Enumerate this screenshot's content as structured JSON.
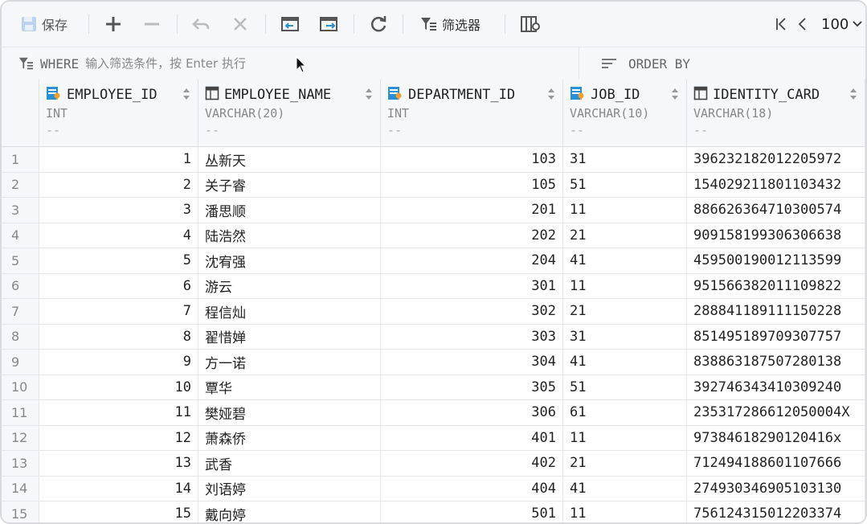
{
  "toolbar": {
    "save_label": "保存",
    "filter_label": "筛选器",
    "page_size": "100"
  },
  "filter": {
    "where_keyword": "WHERE",
    "where_placeholder": "输入筛选条件，按 Enter 执行",
    "order_keyword": "ORDER BY"
  },
  "columns": [
    {
      "name": "EMPLOYEE_ID",
      "type": "INT",
      "dash": "--",
      "icon": "key-column-icon"
    },
    {
      "name": "EMPLOYEE_NAME",
      "type": "VARCHAR(20)",
      "dash": "--",
      "icon": "column-icon"
    },
    {
      "name": "DEPARTMENT_ID",
      "type": "INT",
      "dash": "--",
      "icon": "key-column-icon"
    },
    {
      "name": "JOB_ID",
      "type": "VARCHAR(10)",
      "dash": "--",
      "icon": "key-column-icon"
    },
    {
      "name": "IDENTITY_CARD",
      "type": "VARCHAR(18)",
      "dash": "--",
      "icon": "column-icon"
    }
  ],
  "rows": [
    {
      "n": "1",
      "id": "1",
      "name": "丛新天",
      "dept": "103",
      "job": "31",
      "card": "396232182012205972"
    },
    {
      "n": "2",
      "id": "2",
      "name": "关子睿",
      "dept": "105",
      "job": "51",
      "card": "154029211801103432"
    },
    {
      "n": "3",
      "id": "3",
      "name": "潘思顺",
      "dept": "201",
      "job": "11",
      "card": "886626364710300574"
    },
    {
      "n": "4",
      "id": "4",
      "name": "陆浩然",
      "dept": "202",
      "job": "21",
      "card": "909158199306306638"
    },
    {
      "n": "5",
      "id": "5",
      "name": "沈宥强",
      "dept": "204",
      "job": "41",
      "card": "459500190012113599"
    },
    {
      "n": "6",
      "id": "6",
      "name": "游云",
      "dept": "301",
      "job": "11",
      "card": "951566382011109822"
    },
    {
      "n": "7",
      "id": "7",
      "name": "程信灿",
      "dept": "302",
      "job": "21",
      "card": "288841189111150228"
    },
    {
      "n": "8",
      "id": "8",
      "name": "翟惜婵",
      "dept": "303",
      "job": "31",
      "card": "851495189709307757"
    },
    {
      "n": "9",
      "id": "9",
      "name": "方一诺",
      "dept": "304",
      "job": "41",
      "card": "838863187507280138"
    },
    {
      "n": "10",
      "id": "10",
      "name": "覃华",
      "dept": "305",
      "job": "51",
      "card": "392746343410309240"
    },
    {
      "n": "11",
      "id": "11",
      "name": "樊娅碧",
      "dept": "306",
      "job": "61",
      "card": "235317286612050004X"
    },
    {
      "n": "12",
      "id": "12",
      "name": "萧森侨",
      "dept": "401",
      "job": "11",
      "card": "97384618290120416x"
    },
    {
      "n": "13",
      "id": "13",
      "name": "武香",
      "dept": "402",
      "job": "21",
      "card": "712494188601107666"
    },
    {
      "n": "14",
      "id": "14",
      "name": "刘语婷",
      "dept": "404",
      "job": "41",
      "card": "274930346905103130"
    },
    {
      "n": "15",
      "id": "15",
      "name": "戴向婷",
      "dept": "501",
      "job": "11",
      "card": "756124315012203374"
    }
  ]
}
